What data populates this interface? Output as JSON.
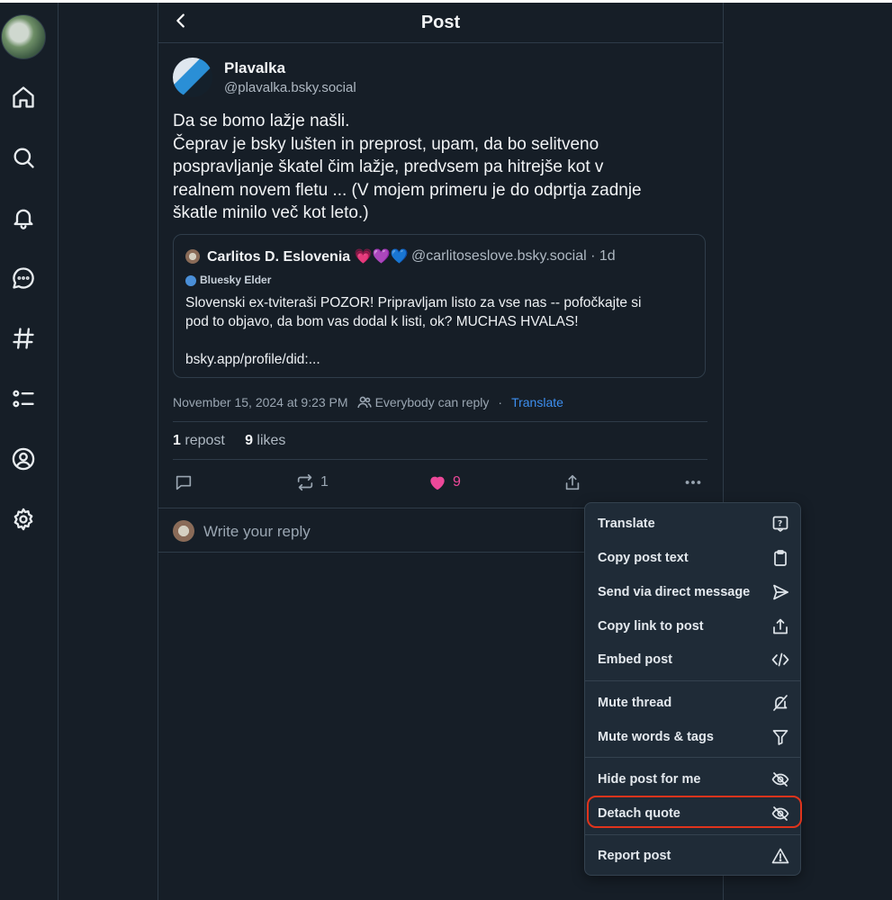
{
  "header": {
    "title": "Post"
  },
  "post": {
    "author_name": "Plavalka",
    "author_handle": "@plavalka.bsky.social",
    "text_lines": [
      "Da se bomo lažje našli.",
      "Čeprav je bsky lušten in preprost, upam, da bo selitveno",
      "pospravljanje škatel čim lažje, predvsem pa hitrejše kot v",
      "realnem novem fletu ... (V mojem primeru je do odprtja zadnje",
      "škatle minilo več kot leto.)"
    ],
    "quote": {
      "author_name": "Carlitos D. Eslovenia 💗💜💙",
      "author_handle": "@carlitoseslove.bsky.social · 1d",
      "badge": "Bluesky Elder",
      "text_lines": [
        "Slovenski ex-tviteraši POZOR! Pripravljam listo za vse nas -- pofočkajte si",
        "pod to objavo, da bom vas dodal k listi, ok? MUCHAS HVALAS!",
        "",
        "bsky.app/profile/did:..."
      ]
    },
    "timestamp": "November 15, 2024 at 9:23 PM",
    "reply_setting": "Everybody can reply",
    "meta_separator": "·",
    "translate_link": "Translate",
    "repost_count": "1",
    "repost_label": "repost",
    "like_count": "9",
    "like_label": "likes",
    "actions": {
      "repost_count": "1",
      "like_count": "9",
      "like_color": "#ec4899"
    }
  },
  "reply": {
    "placeholder": "Write your reply"
  },
  "menu": {
    "items": [
      {
        "label": "Translate",
        "icon": "translate-icon"
      },
      {
        "label": "Copy post text",
        "icon": "clipboard-icon"
      },
      {
        "label": "Send via direct message",
        "icon": "paper-plane-icon"
      },
      {
        "label": "Copy link to post",
        "icon": "share-icon"
      },
      {
        "label": "Embed post",
        "icon": "code-icon"
      },
      {
        "label": "Mute thread",
        "icon": "mute-bell-icon"
      },
      {
        "label": "Mute words & tags",
        "icon": "filter-icon"
      },
      {
        "label": "Hide post for me",
        "icon": "eye-slash-icon"
      },
      {
        "label": "Detach quote",
        "icon": "eye-slash-icon"
      },
      {
        "label": "Report post",
        "icon": "warning-icon"
      }
    ],
    "highlight_color": "#e0341c"
  }
}
